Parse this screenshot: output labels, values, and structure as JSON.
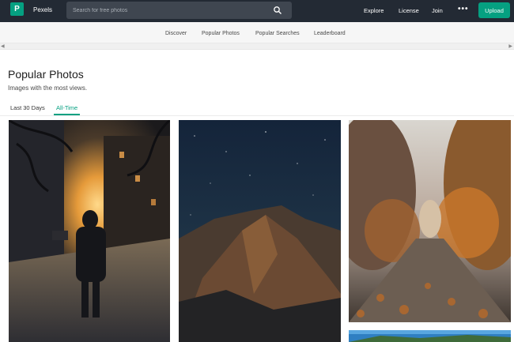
{
  "header": {
    "brand": "Pexels",
    "logo_letter": "P",
    "search_placeholder": "Search for free photos",
    "nav": [
      "Explore",
      "License",
      "Join"
    ],
    "more": "•••",
    "upload": "Upload",
    "colors": {
      "bar": "#232a34",
      "accent": "#05a081"
    }
  },
  "subnav": {
    "items": [
      "Discover",
      "Popular Photos",
      "Popular Searches",
      "Leaderboard"
    ]
  },
  "page": {
    "title": "Popular Photos",
    "subtitle": "Images with the most views.",
    "tabs": [
      "Last 30 Days",
      "All-Time"
    ],
    "active_tab": "All-Time"
  },
  "photos": [
    {
      "icon": "city-street-photo"
    },
    {
      "icon": "mountain-night-photo"
    },
    {
      "icon": "autumn-path-photo"
    },
    {
      "icon": "lake-photo"
    }
  ]
}
